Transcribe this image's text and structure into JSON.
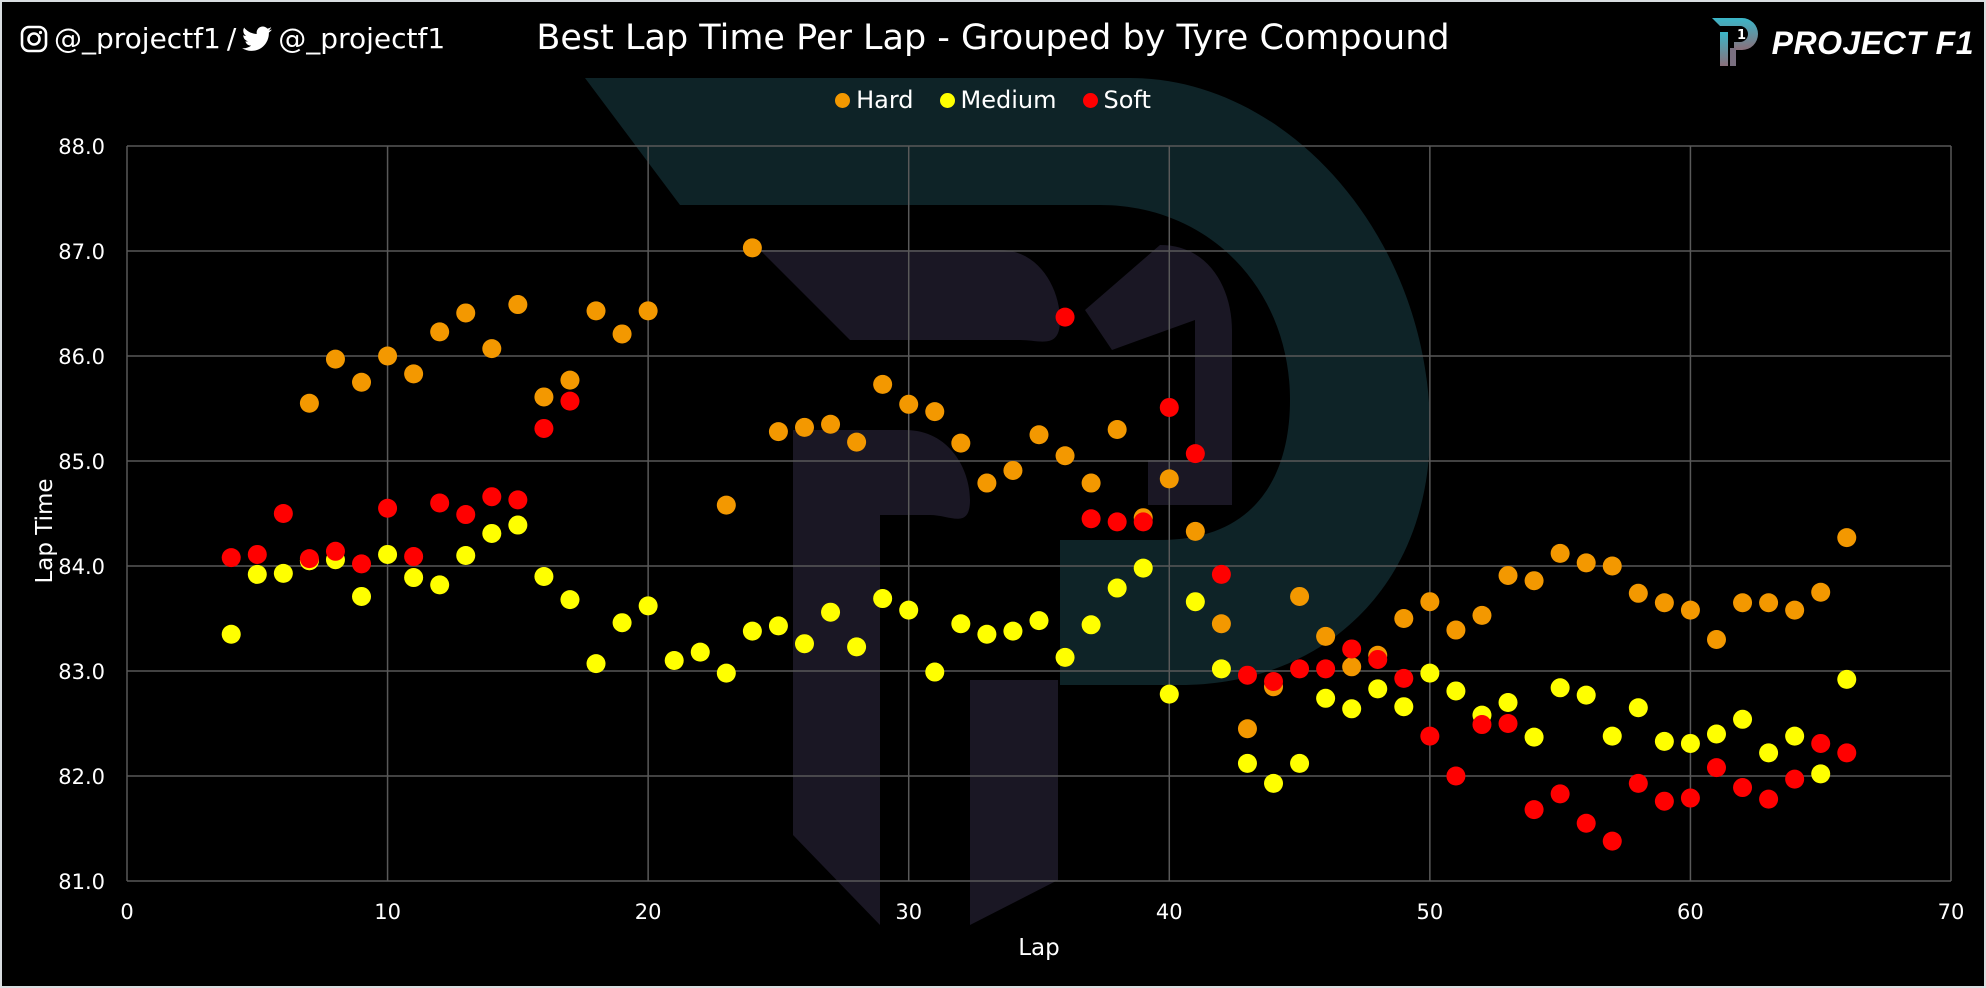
{
  "header": {
    "social_handle_instagram": "@_projectf1",
    "separator": "/",
    "social_handle_twitter": "@_projectf1",
    "brand_name": "PROJECT F1",
    "icons": [
      "instagram-icon",
      "twitter-icon",
      "project-f1-logo"
    ]
  },
  "colors": {
    "background": "#000000",
    "hard": "#f39800",
    "medium": "#ffff00",
    "soft": "#ff0000",
    "grid": "#595959",
    "watermark": "#0f2328"
  },
  "chart_data": {
    "type": "scatter",
    "title": "Best Lap Time Per Lap - Grouped by Tyre Compound",
    "xlabel": "Lap",
    "ylabel": "Lap Time",
    "xlim": [
      0,
      70
    ],
    "ylim": [
      81.0,
      88.0
    ],
    "xticks": [
      "0",
      "10",
      "20",
      "30",
      "40",
      "50",
      "60",
      "70"
    ],
    "yticks": [
      "81.0",
      "82.0",
      "83.0",
      "84.0",
      "85.0",
      "86.0",
      "87.0",
      "88.0"
    ],
    "grid": true,
    "legend_position": "top-center",
    "series": [
      {
        "name": "Hard",
        "color": "#f39800",
        "points": [
          [
            7,
            84.05
          ],
          [
            7,
            85.55
          ],
          [
            8,
            85.97
          ],
          [
            9,
            85.75
          ],
          [
            10,
            86.0
          ],
          [
            11,
            85.83
          ],
          [
            12,
            86.23
          ],
          [
            13,
            86.41
          ],
          [
            14,
            86.07
          ],
          [
            15,
            86.49
          ],
          [
            16,
            85.61
          ],
          [
            17,
            85.77
          ],
          [
            18,
            86.43
          ],
          [
            19,
            86.21
          ],
          [
            20,
            86.43
          ],
          [
            23,
            84.58
          ],
          [
            24,
            87.03
          ],
          [
            25,
            85.28
          ],
          [
            26,
            85.32
          ],
          [
            27,
            85.35
          ],
          [
            28,
            85.18
          ],
          [
            29,
            85.73
          ],
          [
            30,
            85.54
          ],
          [
            31,
            85.47
          ],
          [
            32,
            85.17
          ],
          [
            33,
            84.79
          ],
          [
            34,
            84.91
          ],
          [
            35,
            85.25
          ],
          [
            36,
            85.05
          ],
          [
            37,
            84.79
          ],
          [
            38,
            85.3
          ],
          [
            39,
            84.46
          ],
          [
            40,
            84.83
          ],
          [
            41,
            84.33
          ],
          [
            42,
            83.45
          ],
          [
            43,
            82.45
          ],
          [
            44,
            82.85
          ],
          [
            45,
            83.71
          ],
          [
            46,
            83.33
          ],
          [
            47,
            83.04
          ],
          [
            48,
            83.15
          ],
          [
            49,
            83.5
          ],
          [
            50,
            83.66
          ],
          [
            51,
            83.39
          ],
          [
            52,
            83.53
          ],
          [
            53,
            83.91
          ],
          [
            54,
            83.86
          ],
          [
            55,
            84.12
          ],
          [
            56,
            84.03
          ],
          [
            57,
            84.0
          ],
          [
            58,
            83.74
          ],
          [
            59,
            83.65
          ],
          [
            60,
            83.58
          ],
          [
            61,
            83.3
          ],
          [
            62,
            83.65
          ],
          [
            63,
            83.65
          ],
          [
            64,
            83.58
          ],
          [
            65,
            83.75
          ],
          [
            66,
            84.27
          ]
        ]
      },
      {
        "name": "Medium",
        "color": "#ffff00",
        "points": [
          [
            4,
            83.35
          ],
          [
            5,
            83.92
          ],
          [
            6,
            83.93
          ],
          [
            7,
            84.05
          ],
          [
            8,
            84.06
          ],
          [
            9,
            83.71
          ],
          [
            10,
            84.11
          ],
          [
            11,
            83.89
          ],
          [
            12,
            83.82
          ],
          [
            13,
            84.1
          ],
          [
            14,
            84.31
          ],
          [
            15,
            84.39
          ],
          [
            16,
            83.9
          ],
          [
            17,
            83.68
          ],
          [
            18,
            83.07
          ],
          [
            19,
            83.46
          ],
          [
            20,
            83.62
          ],
          [
            21,
            83.1
          ],
          [
            22,
            83.18
          ],
          [
            23,
            82.98
          ],
          [
            24,
            83.38
          ],
          [
            25,
            83.43
          ],
          [
            26,
            83.26
          ],
          [
            27,
            83.56
          ],
          [
            28,
            83.23
          ],
          [
            29,
            83.69
          ],
          [
            30,
            83.58
          ],
          [
            31,
            82.99
          ],
          [
            32,
            83.45
          ],
          [
            33,
            83.35
          ],
          [
            34,
            83.38
          ],
          [
            35,
            83.48
          ],
          [
            36,
            83.13
          ],
          [
            37,
            83.44
          ],
          [
            38,
            83.79
          ],
          [
            39,
            83.98
          ],
          [
            40,
            82.78
          ],
          [
            41,
            83.66
          ],
          [
            42,
            83.02
          ],
          [
            43,
            82.12
          ],
          [
            44,
            81.93
          ],
          [
            45,
            82.12
          ],
          [
            46,
            82.74
          ],
          [
            47,
            82.64
          ],
          [
            48,
            82.83
          ],
          [
            49,
            82.66
          ],
          [
            50,
            82.98
          ],
          [
            51,
            82.81
          ],
          [
            52,
            82.58
          ],
          [
            53,
            82.7
          ],
          [
            54,
            82.37
          ],
          [
            55,
            82.84
          ],
          [
            56,
            82.77
          ],
          [
            57,
            82.38
          ],
          [
            58,
            82.65
          ],
          [
            59,
            82.33
          ],
          [
            60,
            82.31
          ],
          [
            61,
            82.4
          ],
          [
            62,
            82.54
          ],
          [
            63,
            82.22
          ],
          [
            64,
            82.38
          ],
          [
            65,
            82.02
          ],
          [
            66,
            82.92
          ]
        ]
      },
      {
        "name": "Soft",
        "color": "#ff0000",
        "points": [
          [
            4,
            84.08
          ],
          [
            5,
            84.11
          ],
          [
            6,
            84.5
          ],
          [
            7,
            84.07
          ],
          [
            8,
            84.14
          ],
          [
            9,
            84.02
          ],
          [
            10,
            84.55
          ],
          [
            11,
            84.09
          ],
          [
            12,
            84.6
          ],
          [
            13,
            84.49
          ],
          [
            14,
            84.66
          ],
          [
            15,
            84.63
          ],
          [
            16,
            85.31
          ],
          [
            17,
            85.57
          ],
          [
            36,
            86.37
          ],
          [
            37,
            84.45
          ],
          [
            38,
            84.42
          ],
          [
            39,
            84.42
          ],
          [
            40,
            85.51
          ],
          [
            41,
            85.07
          ],
          [
            42,
            83.92
          ],
          [
            43,
            82.96
          ],
          [
            44,
            82.9
          ],
          [
            45,
            83.02
          ],
          [
            46,
            83.02
          ],
          [
            47,
            83.21
          ],
          [
            48,
            83.11
          ],
          [
            49,
            82.93
          ],
          [
            50,
            82.38
          ],
          [
            51,
            82.0
          ],
          [
            52,
            82.49
          ],
          [
            53,
            82.5
          ],
          [
            54,
            81.68
          ],
          [
            55,
            81.83
          ],
          [
            56,
            81.55
          ],
          [
            57,
            81.38
          ],
          [
            58,
            81.93
          ],
          [
            59,
            81.76
          ],
          [
            60,
            81.79
          ],
          [
            61,
            82.08
          ],
          [
            62,
            81.89
          ],
          [
            63,
            81.78
          ],
          [
            64,
            81.97
          ],
          [
            65,
            82.31
          ],
          [
            66,
            82.22
          ]
        ]
      }
    ]
  }
}
